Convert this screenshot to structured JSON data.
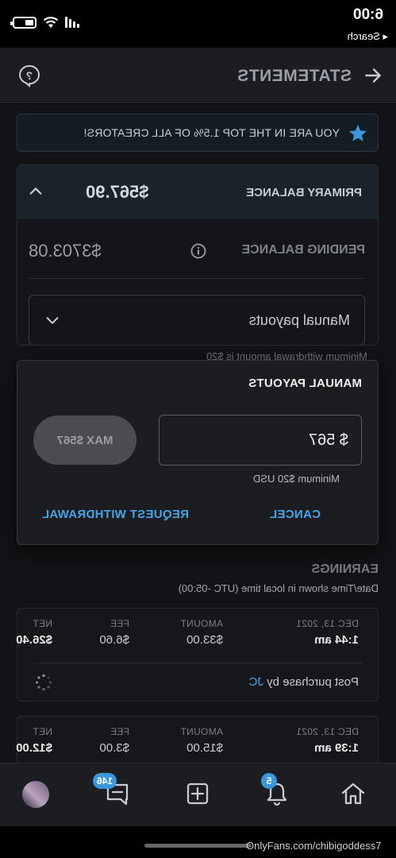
{
  "status_bar": {
    "time": "6:00",
    "back_label": "◂ Search"
  },
  "header": {
    "title": "STATEMENTS"
  },
  "banner": {
    "text": "YOU ARE IN THE TOP 1.5% OF ALL CREATORS!"
  },
  "balances": {
    "primary_label": "PRIMARY BALANCE",
    "primary_amount": "$567.90",
    "pending_label": "PENDING BALANCE",
    "pending_amount": "$3703.08",
    "payout_mode": "Manual payouts",
    "min_note": "Minimum withdrawal amount is $20"
  },
  "dialog": {
    "title": "MANUAL PAYOUTS",
    "amount_value": "$ 567",
    "max_label": "MAX $567",
    "min_note": "Minimum $20 USD",
    "cancel_label": "CANCEL",
    "request_label": "REQUEST WITHDRAWAL"
  },
  "earnings": {
    "title": "EARNINGS",
    "subtitle": "Date/Time shown in local time (UTC -05:00)",
    "columns": {
      "date": "DEC 13, 2021",
      "amount": "AMOUNT",
      "fee": "FEE",
      "net": "NET"
    },
    "rows": [
      {
        "date": "DEC 13, 2021",
        "time": "1:44 am",
        "amount": "$33.00",
        "fee": "$6.60",
        "net": "$26.40",
        "desc_prefix": "Post purchase by",
        "desc_user": "JC"
      },
      {
        "date": "DEC 13, 2021",
        "time": "1:39 am",
        "amount": "$15.00",
        "fee": "$3.00",
        "net": "$12.00"
      }
    ]
  },
  "tabbar": {
    "notifications_badge": "5",
    "messages_badge": "146"
  },
  "watermark": "OnlyFans.com/chibigoddess7",
  "colors": {
    "accent": "#4aa3e6",
    "badge": "#3b97d9",
    "background": "#121316"
  }
}
